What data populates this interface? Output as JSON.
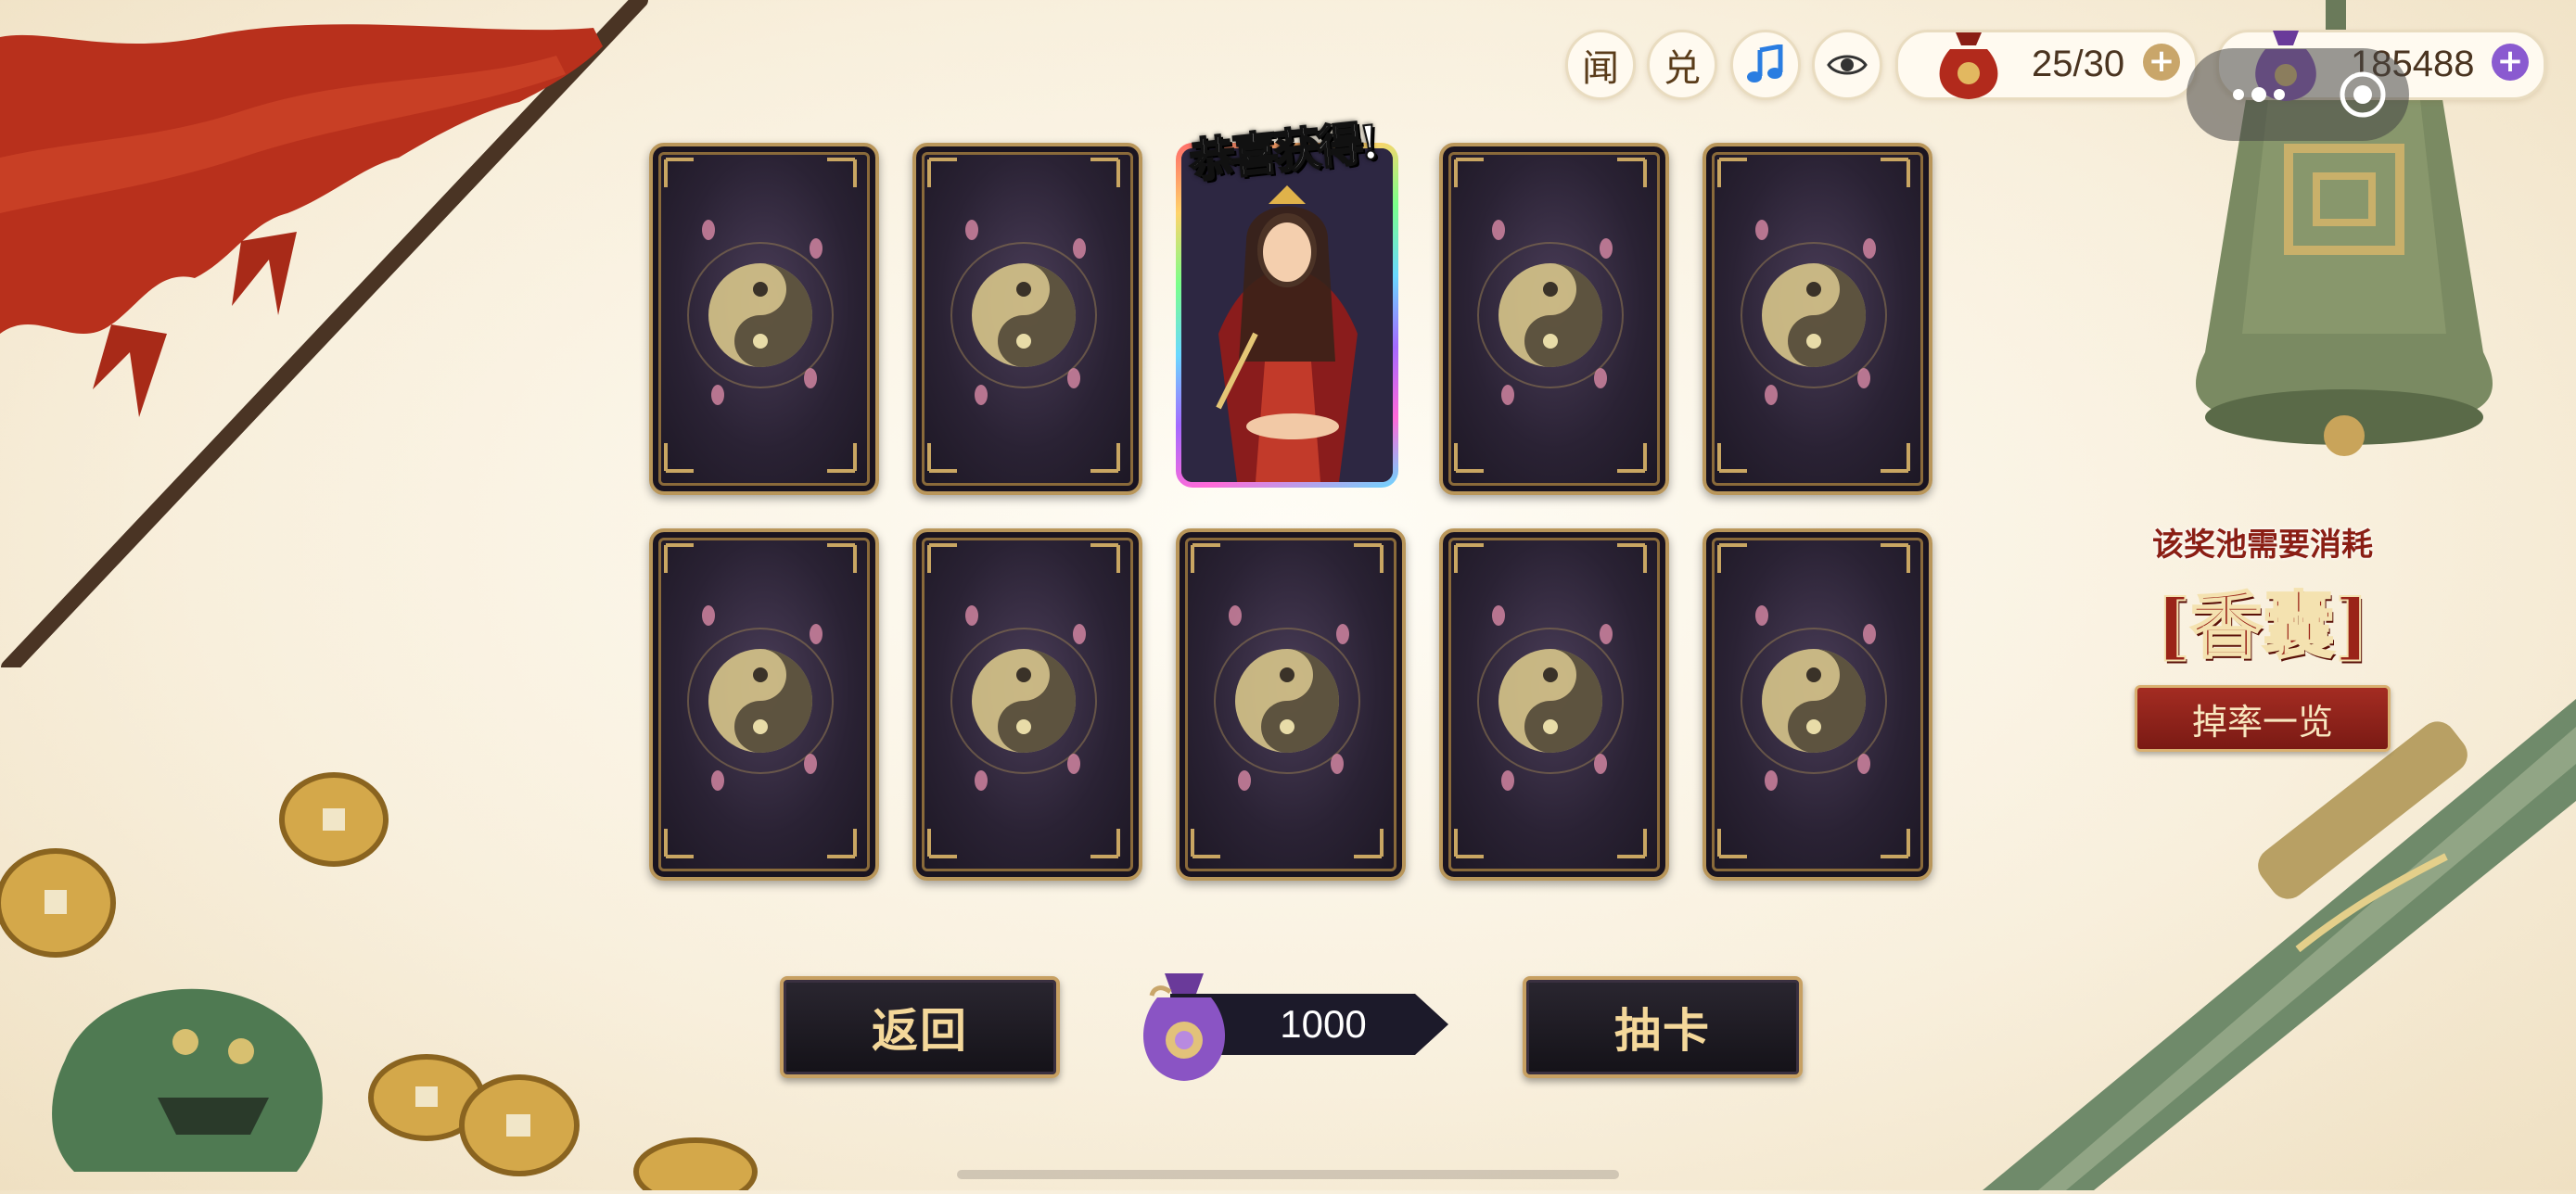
{
  "hud": {
    "news_label": "闻",
    "exchange_label": "兑",
    "music_icon": "music-note-icon",
    "eye_icon": "eye-icon",
    "sachet_count": "25/30",
    "currency_amount": "185488"
  },
  "cards": {
    "rows": 2,
    "per_row": 5,
    "revealed_index": 2,
    "revealed_banner": "恭喜获得!"
  },
  "pool": {
    "requirement_label": "该奖池需要消耗",
    "item_label": "[香囊]",
    "drop_rate_button": "掉率一览"
  },
  "bottom": {
    "back_button": "返回",
    "cost_amount": "1000",
    "draw_button": "抽卡"
  },
  "colors": {
    "card_border": "#b9965a",
    "accent_red": "#9a2418",
    "button_gold": "#f4d89a"
  }
}
